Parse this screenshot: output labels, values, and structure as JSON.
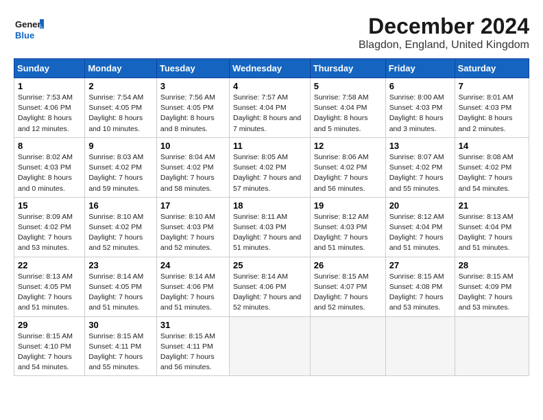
{
  "header": {
    "logo_line1": "General",
    "logo_line2": "Blue",
    "main_title": "December 2024",
    "subtitle": "Blagdon, England, United Kingdom"
  },
  "calendar": {
    "weekdays": [
      "Sunday",
      "Monday",
      "Tuesday",
      "Wednesday",
      "Thursday",
      "Friday",
      "Saturday"
    ],
    "weeks": [
      [
        {
          "day": "1",
          "sunrise": "7:53 AM",
          "sunset": "4:06 PM",
          "daylight": "8 hours and 12 minutes."
        },
        {
          "day": "2",
          "sunrise": "7:54 AM",
          "sunset": "4:05 PM",
          "daylight": "8 hours and 10 minutes."
        },
        {
          "day": "3",
          "sunrise": "7:56 AM",
          "sunset": "4:05 PM",
          "daylight": "8 hours and 8 minutes."
        },
        {
          "day": "4",
          "sunrise": "7:57 AM",
          "sunset": "4:04 PM",
          "daylight": "8 hours and 7 minutes."
        },
        {
          "day": "5",
          "sunrise": "7:58 AM",
          "sunset": "4:04 PM",
          "daylight": "8 hours and 5 minutes."
        },
        {
          "day": "6",
          "sunrise": "8:00 AM",
          "sunset": "4:03 PM",
          "daylight": "8 hours and 3 minutes."
        },
        {
          "day": "7",
          "sunrise": "8:01 AM",
          "sunset": "4:03 PM",
          "daylight": "8 hours and 2 minutes."
        }
      ],
      [
        {
          "day": "8",
          "sunrise": "8:02 AM",
          "sunset": "4:03 PM",
          "daylight": "8 hours and 0 minutes."
        },
        {
          "day": "9",
          "sunrise": "8:03 AM",
          "sunset": "4:02 PM",
          "daylight": "7 hours and 59 minutes."
        },
        {
          "day": "10",
          "sunrise": "8:04 AM",
          "sunset": "4:02 PM",
          "daylight": "7 hours and 58 minutes."
        },
        {
          "day": "11",
          "sunrise": "8:05 AM",
          "sunset": "4:02 PM",
          "daylight": "7 hours and 57 minutes."
        },
        {
          "day": "12",
          "sunrise": "8:06 AM",
          "sunset": "4:02 PM",
          "daylight": "7 hours and 56 minutes."
        },
        {
          "day": "13",
          "sunrise": "8:07 AM",
          "sunset": "4:02 PM",
          "daylight": "7 hours and 55 minutes."
        },
        {
          "day": "14",
          "sunrise": "8:08 AM",
          "sunset": "4:02 PM",
          "daylight": "7 hours and 54 minutes."
        }
      ],
      [
        {
          "day": "15",
          "sunrise": "8:09 AM",
          "sunset": "4:02 PM",
          "daylight": "7 hours and 53 minutes."
        },
        {
          "day": "16",
          "sunrise": "8:10 AM",
          "sunset": "4:02 PM",
          "daylight": "7 hours and 52 minutes."
        },
        {
          "day": "17",
          "sunrise": "8:10 AM",
          "sunset": "4:03 PM",
          "daylight": "7 hours and 52 minutes."
        },
        {
          "day": "18",
          "sunrise": "8:11 AM",
          "sunset": "4:03 PM",
          "daylight": "7 hours and 51 minutes."
        },
        {
          "day": "19",
          "sunrise": "8:12 AM",
          "sunset": "4:03 PM",
          "daylight": "7 hours and 51 minutes."
        },
        {
          "day": "20",
          "sunrise": "8:12 AM",
          "sunset": "4:04 PM",
          "daylight": "7 hours and 51 minutes."
        },
        {
          "day": "21",
          "sunrise": "8:13 AM",
          "sunset": "4:04 PM",
          "daylight": "7 hours and 51 minutes."
        }
      ],
      [
        {
          "day": "22",
          "sunrise": "8:13 AM",
          "sunset": "4:05 PM",
          "daylight": "7 hours and 51 minutes."
        },
        {
          "day": "23",
          "sunrise": "8:14 AM",
          "sunset": "4:05 PM",
          "daylight": "7 hours and 51 minutes."
        },
        {
          "day": "24",
          "sunrise": "8:14 AM",
          "sunset": "4:06 PM",
          "daylight": "7 hours and 51 minutes."
        },
        {
          "day": "25",
          "sunrise": "8:14 AM",
          "sunset": "4:06 PM",
          "daylight": "7 hours and 52 minutes."
        },
        {
          "day": "26",
          "sunrise": "8:15 AM",
          "sunset": "4:07 PM",
          "daylight": "7 hours and 52 minutes."
        },
        {
          "day": "27",
          "sunrise": "8:15 AM",
          "sunset": "4:08 PM",
          "daylight": "7 hours and 53 minutes."
        },
        {
          "day": "28",
          "sunrise": "8:15 AM",
          "sunset": "4:09 PM",
          "daylight": "7 hours and 53 minutes."
        }
      ],
      [
        {
          "day": "29",
          "sunrise": "8:15 AM",
          "sunset": "4:10 PM",
          "daylight": "7 hours and 54 minutes."
        },
        {
          "day": "30",
          "sunrise": "8:15 AM",
          "sunset": "4:11 PM",
          "daylight": "7 hours and 55 minutes."
        },
        {
          "day": "31",
          "sunrise": "8:15 AM",
          "sunset": "4:11 PM",
          "daylight": "7 hours and 56 minutes."
        },
        null,
        null,
        null,
        null
      ]
    ]
  }
}
